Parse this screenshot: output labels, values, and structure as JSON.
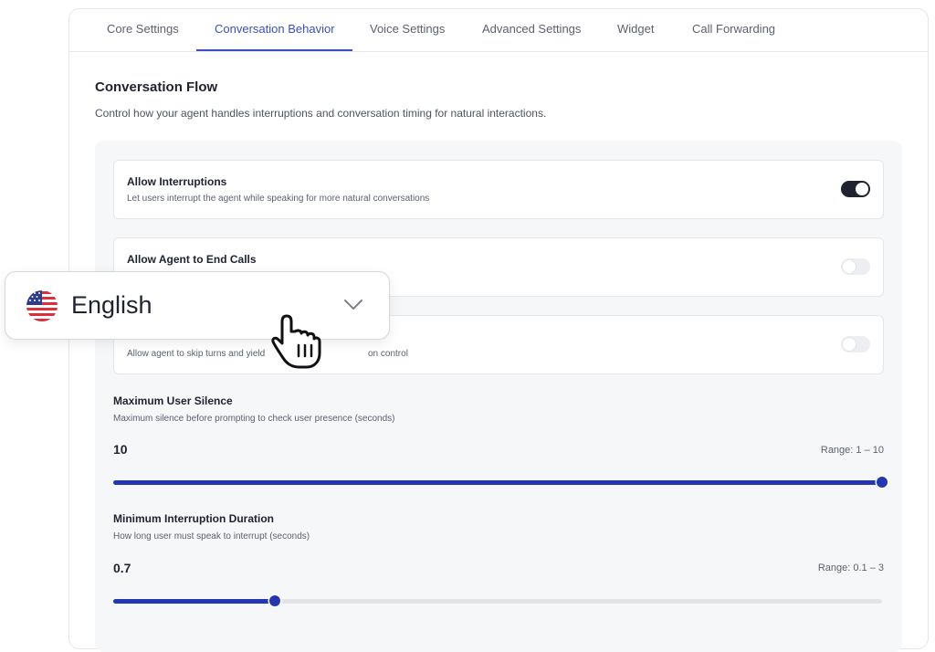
{
  "tabs": [
    {
      "label": "Core Settings"
    },
    {
      "label": "Conversation Behavior",
      "active": true
    },
    {
      "label": "Voice Settings"
    },
    {
      "label": "Advanced Settings"
    },
    {
      "label": "Widget"
    },
    {
      "label": "Call Forwarding"
    }
  ],
  "section": {
    "title": "Conversation Flow",
    "description": "Control how your agent handles interruptions and conversation timing for natural interactions."
  },
  "settings": [
    {
      "title": "Allow Interruptions",
      "description": "Let users interrupt the agent while speaking for more natural conversations",
      "enabled": true
    },
    {
      "title": "Allow Agent to End Calls",
      "description": "",
      "enabled": false
    },
    {
      "title": "",
      "description": "Allow agent to skip turns and yield",
      "description_tail": "on control",
      "enabled": false
    }
  ],
  "sliders": [
    {
      "label": "Maximum User Silence",
      "description": "Maximum silence before prompting to check user presence (seconds)",
      "value": "10",
      "range": "Range: 1 – 10",
      "fraction": 1.0
    },
    {
      "label": "Minimum Interruption Duration",
      "description": "How long user must speak to interrupt (seconds)",
      "value": "0.7",
      "range": "Range: 0.1 – 3",
      "fraction": 0.21
    }
  ],
  "language_dropdown": {
    "selected": "English",
    "flag_icon": "us-flag-icon",
    "chevron_icon": "chevron-down-icon"
  },
  "colors": {
    "accent": "#3b4fc4",
    "slider": "#2436b0",
    "toggle_on": "#1f2330",
    "toggle_off": "#eceef1"
  }
}
